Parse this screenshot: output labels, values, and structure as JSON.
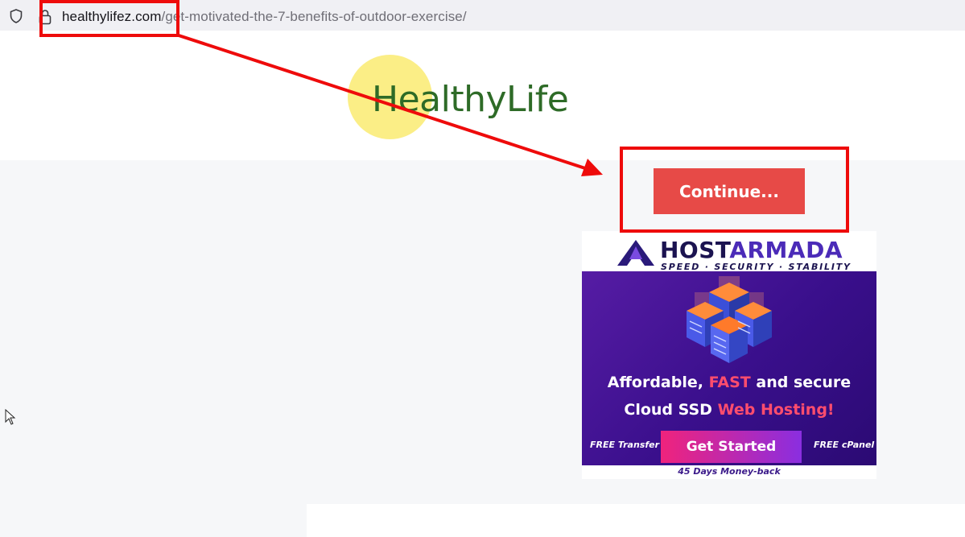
{
  "browser": {
    "url_domain": "healthylifez.com",
    "url_path": "/get-motivated-the-7-benefits-of-outdoor-exercise/",
    "icons": [
      "shield-icon",
      "lock-icon"
    ]
  },
  "header": {
    "logo_text": "HealthyLife"
  },
  "main": {
    "continue_label": "Continue..."
  },
  "ad": {
    "brand_host": "HOST",
    "brand_armada": "ARMADA",
    "tagline": "SPEED · SECURITY · STABILITY",
    "line1_a": "Affordable,",
    "line1_b": "FAST",
    "line1_c": "and secure",
    "line2_a": "Cloud SSD",
    "line2_b": "Web Hosting!",
    "free_left": "FREE Transfer",
    "free_right": "FREE cPanel",
    "cta": "Get Started",
    "moneyback": "45 Days Money-back"
  },
  "colors": {
    "accent_red": "#e74a47",
    "annotation_red": "#ee0b0b",
    "logo_green": "#2e6b27",
    "logo_yellow": "#fbee86",
    "ad_purple": "#3a0f8c"
  }
}
